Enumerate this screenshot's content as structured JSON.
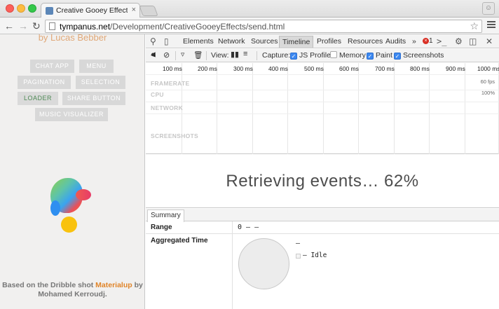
{
  "browser": {
    "tab_title": "Creative Gooey Effects: Lo",
    "tab_close": "×",
    "url_host": "tympanus.net",
    "url_path": "/Development/CreativeGooeyEffects/send.html"
  },
  "page": {
    "byline": "by Lucas Bebber",
    "buttons": [
      {
        "label": "CHAT APP",
        "active": false
      },
      {
        "label": "MENU",
        "active": false
      },
      {
        "label": "PAGINATION",
        "active": false
      },
      {
        "label": "SELECTION",
        "active": false
      },
      {
        "label": "LOADER",
        "active": true
      },
      {
        "label": "SHARE BUTTON",
        "active": false
      },
      {
        "label": "MUSIC VISUALIZER",
        "active": false
      }
    ],
    "credit_prefix": "Based on the Dribble shot ",
    "credit_link": "Materialup",
    "credit_suffix": " by",
    "credit_line2": "Mohamed Kerroudj."
  },
  "devtools": {
    "tabs": [
      "Elements",
      "Network",
      "Sources",
      "Timeline",
      "Profiles",
      "Resources",
      "Audits"
    ],
    "selected_tab": "Timeline",
    "more_tabs": "»",
    "error_count": "1",
    "toolbar": {
      "view_label": "View:",
      "capture_label": "Capture:",
      "js_profile": {
        "label": "JS Profile",
        "checked": true
      },
      "memory": {
        "label": "Memory",
        "checked": false
      },
      "paint": {
        "label": "Paint",
        "checked": true
      },
      "screenshots": {
        "label": "Screenshots",
        "checked": true
      }
    },
    "ruler": [
      "100 ms",
      "200 ms",
      "300 ms",
      "400 ms",
      "500 ms",
      "600 ms",
      "700 ms",
      "800 ms",
      "900 ms",
      "1000 ms"
    ],
    "rows": {
      "framerate": "FRAMERATE",
      "cpu": "CPU",
      "network": "NETWORK",
      "screenshots": "SCREENSHOTS",
      "fps": "60 fps",
      "cpu_pct": "100%"
    },
    "loading": {
      "text": "Retrieving events… 62%",
      "progress_pct": 62
    },
    "summary": {
      "tab": "Summary",
      "range_key": "Range",
      "range_value": "0 – –",
      "agg_key": "Aggregated Time",
      "pie_total": "–",
      "legend_label": "– Idle"
    }
  }
}
